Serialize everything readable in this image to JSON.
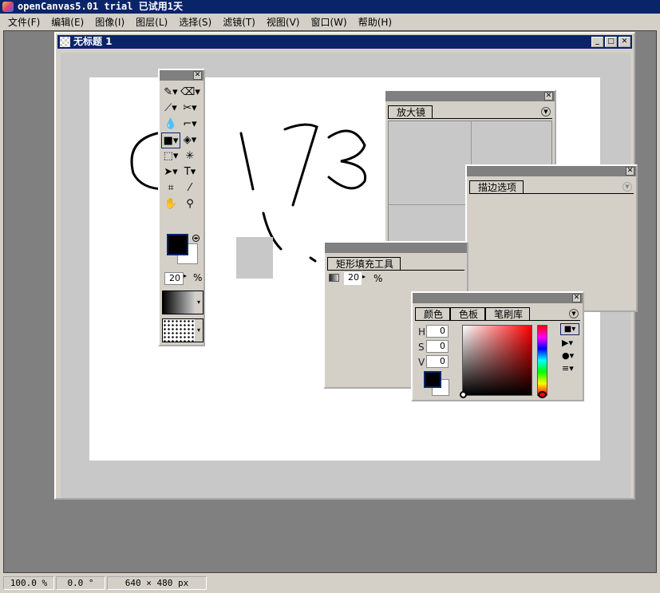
{
  "app": {
    "title": "openCanvas5.01 trial 已试用1天"
  },
  "menu": [
    "文件(F)",
    "编辑(E)",
    "图像(I)",
    "图层(L)",
    "选择(S)",
    "滤镜(T)",
    "视图(V)",
    "窗口(W)",
    "帮助(H)"
  ],
  "document": {
    "title": "无标题 1"
  },
  "toolbox": {
    "opacity": "20",
    "percent": "%"
  },
  "panels": {
    "magnifier": {
      "tab": "放大镜"
    },
    "stroke": {
      "tab": "描边选项"
    },
    "rectfill": {
      "tab": "矩形填充工具",
      "opacity": "20",
      "percent": "%"
    },
    "color": {
      "tabs": [
        "颜色",
        "色板",
        "笔刷库"
      ],
      "h_label": "H",
      "s_label": "S",
      "v_label": "V",
      "h": "0",
      "s": "0",
      "v": "0"
    }
  },
  "status": {
    "zoom": "100.0 %",
    "angle": "0.0 °",
    "size": "640 × 480 px"
  },
  "colors": {
    "titlebar": "#0a246a",
    "face": "#d4d0c8",
    "workspace": "#808080"
  }
}
